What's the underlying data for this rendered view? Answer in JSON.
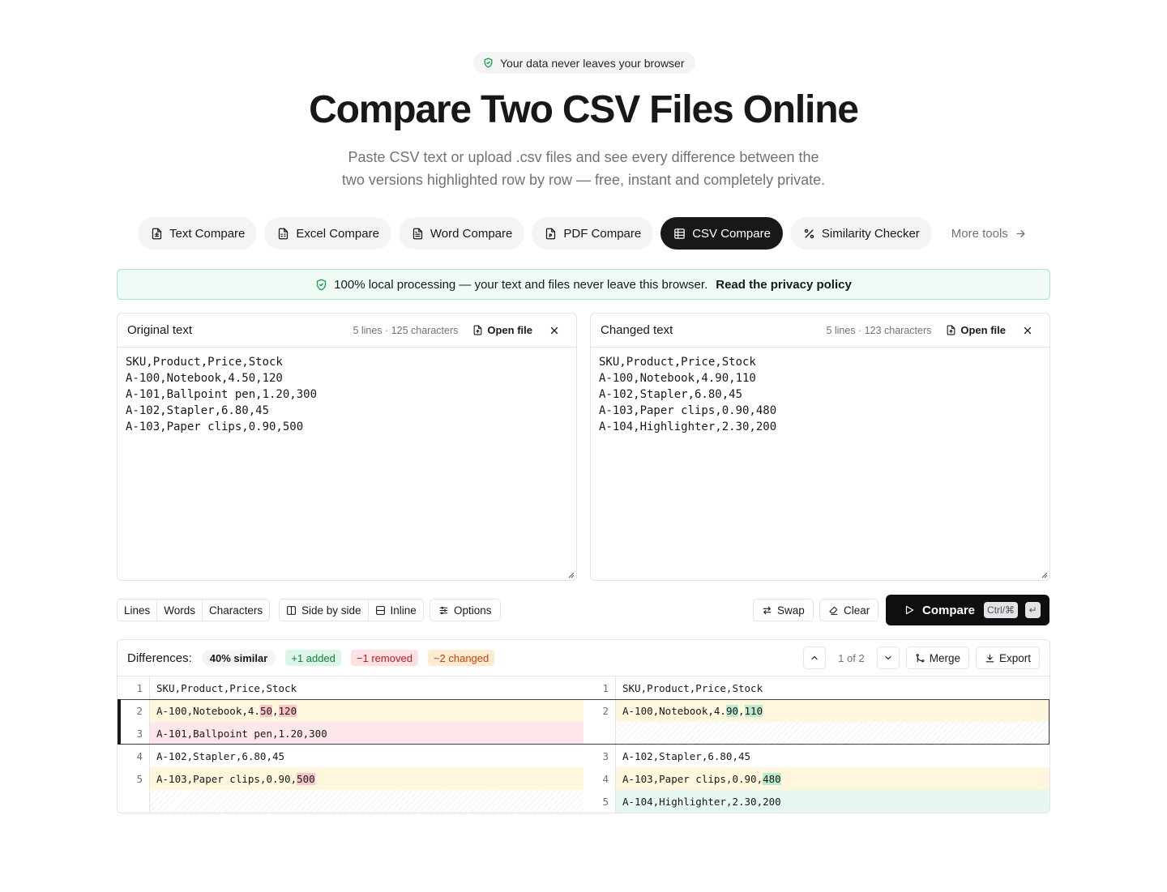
{
  "header": {
    "badge": "Your data never leaves your browser",
    "title": "Compare Two CSV Files Online",
    "subtitle_line1": "Paste CSV text or upload .csv files and see every difference between the",
    "subtitle_line2": "two versions highlighted row by row — free, instant and completely private."
  },
  "tools": [
    {
      "label": "Text Compare",
      "icon": "file-text-icon"
    },
    {
      "label": "Excel Compare",
      "icon": "file-spreadsheet-icon"
    },
    {
      "label": "Word Compare",
      "icon": "file-doc-icon"
    },
    {
      "label": "PDF Compare",
      "icon": "file-pdf-icon"
    },
    {
      "label": "CSV Compare",
      "icon": "table-icon",
      "active": true
    },
    {
      "label": "Similarity Checker",
      "icon": "percent-icon"
    }
  ],
  "more_tools": "More tools",
  "privacy": {
    "text": "100% local processing — your text and files never leave this browser.",
    "link": "Read the privacy policy"
  },
  "original": {
    "title": "Original text",
    "meta": "5 lines · 125 characters",
    "open_file": "Open file",
    "content": "SKU,Product,Price,Stock\nA-100,Notebook,4.50,120\nA-101,Ballpoint pen,1.20,300\nA-102,Stapler,6.80,45\nA-103,Paper clips,0.90,500"
  },
  "changed": {
    "title": "Changed text",
    "meta": "5 lines · 123 characters",
    "open_file": "Open file",
    "content": "SKU,Product,Price,Stock\nA-100,Notebook,4.90,110\nA-102,Stapler,6.80,45\nA-103,Paper clips,0.90,480\nA-104,Highlighter,2.30,200"
  },
  "controls": {
    "granularity": [
      "Lines",
      "Words",
      "Characters"
    ],
    "view_side": "Side by side",
    "view_inline": "Inline",
    "options": "Options",
    "swap": "Swap",
    "clear": "Clear",
    "compare": "Compare",
    "shortcut": "Ctrl/⌘",
    "enter": "↵"
  },
  "diff": {
    "title": "Differences:",
    "similar": "40% similar",
    "added": "+1 added",
    "removed": "−1 removed",
    "changed": "~2 changed",
    "counter": "1 of 2",
    "merge": "Merge",
    "export": "Export",
    "rows": [
      {
        "l_no": "1",
        "l_parts": [
          [
            "SKU,Product,Price,Stock",
            ""
          ]
        ],
        "r_no": "1",
        "r_parts": [
          [
            "SKU,Product,Price,Stock",
            ""
          ]
        ],
        "type": "same"
      },
      {
        "l_no": "2",
        "l_parts": [
          [
            "A-100,Notebook,4.",
            ""
          ],
          [
            "50",
            "rem"
          ],
          [
            ",",
            ""
          ],
          [
            "120",
            "rem"
          ]
        ],
        "r_no": "2",
        "r_parts": [
          [
            "A-100,Notebook,4.",
            ""
          ],
          [
            "90",
            "add"
          ],
          [
            ",",
            ""
          ],
          [
            "110",
            "add"
          ]
        ],
        "type": "changed"
      },
      {
        "l_no": "3",
        "l_parts": [
          [
            "A-101,Ballpoint pen,1.20,300",
            ""
          ]
        ],
        "r_no": "",
        "r_parts": [],
        "type": "removed"
      },
      {
        "l_no": "4",
        "l_parts": [
          [
            "A-102,Stapler,6.80,45",
            ""
          ]
        ],
        "r_no": "3",
        "r_parts": [
          [
            "A-102,Stapler,6.80,45",
            ""
          ]
        ],
        "type": "same"
      },
      {
        "l_no": "5",
        "l_parts": [
          [
            "A-103,Paper clips,0.90,",
            ""
          ],
          [
            "500",
            "rem"
          ]
        ],
        "r_no": "4",
        "r_parts": [
          [
            "A-103,Paper clips,0.90,",
            ""
          ],
          [
            "480",
            "add"
          ]
        ],
        "type": "changed"
      },
      {
        "l_no": "",
        "l_parts": [],
        "r_no": "5",
        "r_parts": [
          [
            "A-104,Highlighter,2.30,200",
            ""
          ]
        ],
        "type": "added"
      }
    ]
  }
}
